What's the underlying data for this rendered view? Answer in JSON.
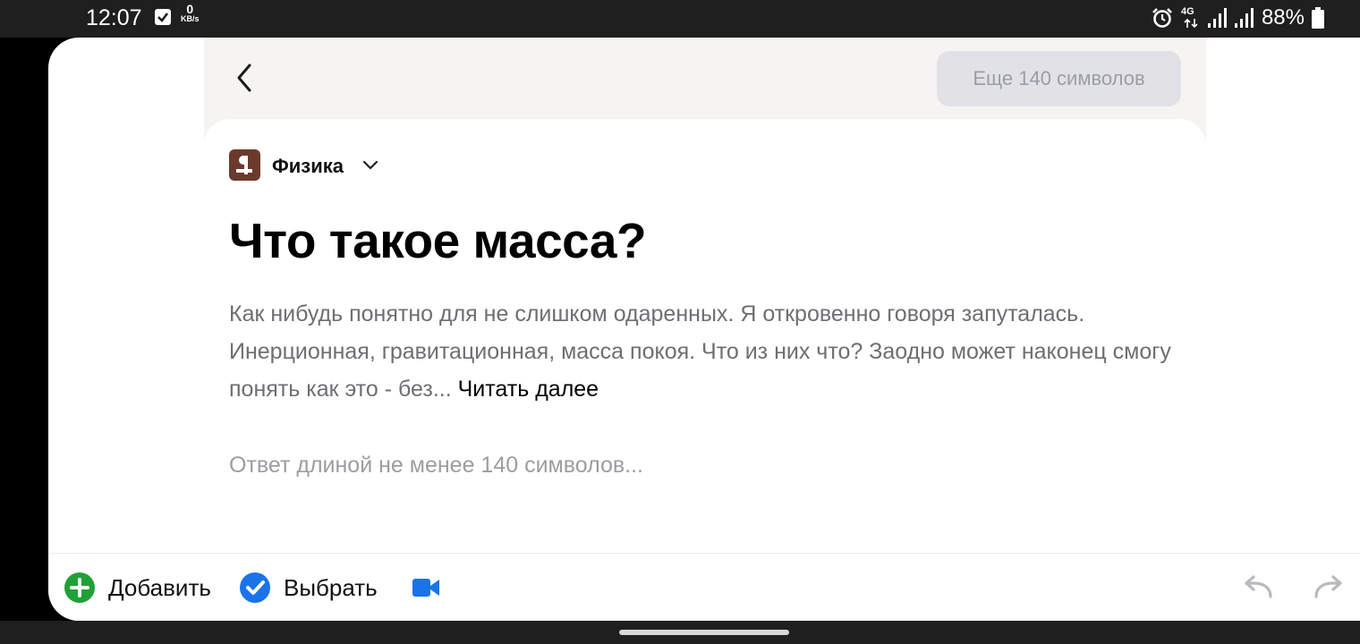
{
  "status_bar": {
    "time": "12:07",
    "net_speed_value": "0",
    "net_speed_unit": "KB/s",
    "network_type": "4G",
    "battery": "88%"
  },
  "header": {
    "back_icon": "chevron-left-icon",
    "more_chars_button": "Еще 140 символов"
  },
  "question": {
    "topic": "Физика",
    "title": "Что такое масса?",
    "body": "Как нибудь понятно для не слишком одаренных. Я откровенно говоря запуталась. Инерционная, гравитационная, масса покоя. Что из них что? Заодно может наконец смогу понять как это - без...",
    "read_more": "Читать далее"
  },
  "answer": {
    "placeholder": "Ответ длиной не менее 140 символов..."
  },
  "toolbar": {
    "add_label": "Добавить",
    "select_label": "Выбрать",
    "colors": {
      "add": "#21a038",
      "select": "#1a73e8",
      "video": "#1a73e8"
    }
  }
}
